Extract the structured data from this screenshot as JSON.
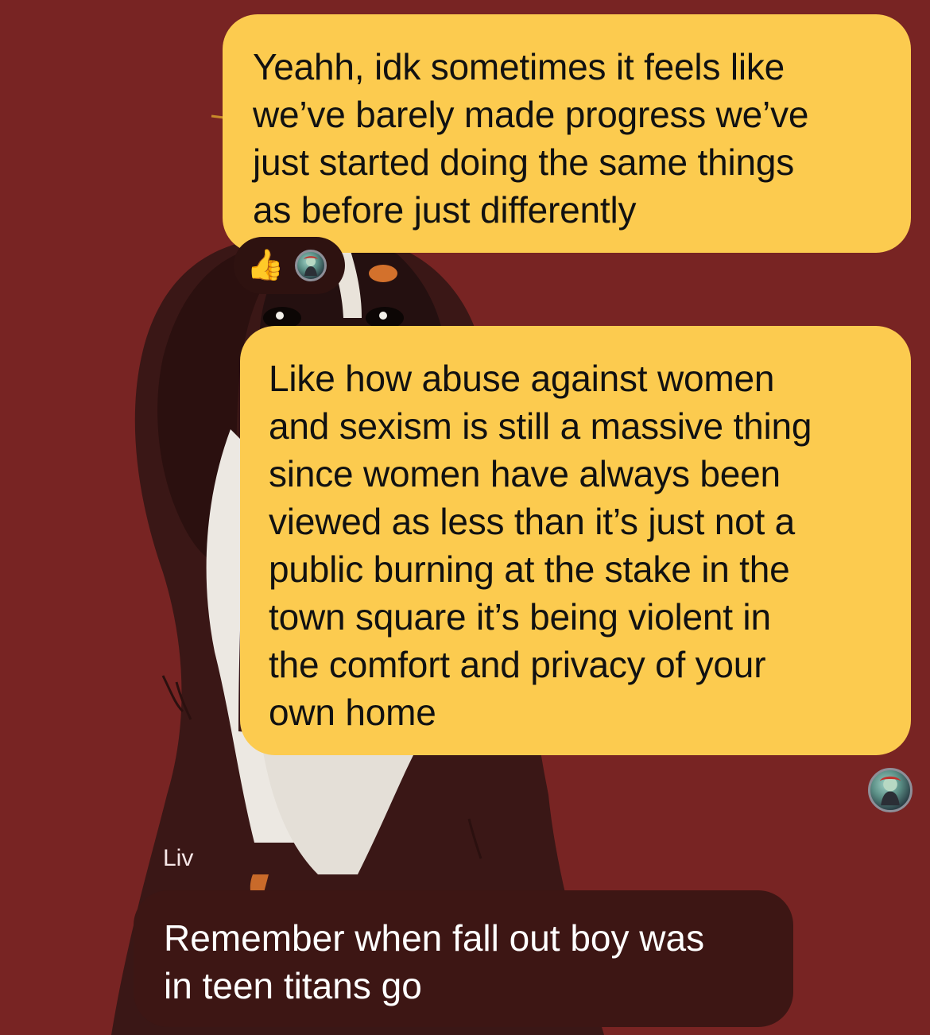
{
  "colors": {
    "background": "#782423",
    "outgoing_bubble": "#fccb4f",
    "incoming_bubble": "#3d1614"
  },
  "messages": [
    {
      "direction": "outgoing",
      "lines": [
        "Yeahh, idk sometimes it feels like",
        "we’ve barely made progress we’ve",
        "just started doing the same things",
        "as before just differently"
      ],
      "reaction_icon": "thumbs-up-icon"
    },
    {
      "direction": "outgoing",
      "lines": [
        "Like how abuse against women",
        "and sexism is still a massive thing",
        "since women have always been",
        "viewed as less than it’s just not a",
        "public burning at the stake in the",
        "town square it’s being violent in",
        "the comfort and privacy of your",
        "own home"
      ]
    },
    {
      "direction": "incoming",
      "sender": "Liv",
      "lines": [
        "Remember when fall out boy was",
        "in teen titans go"
      ]
    }
  ],
  "reaction": {
    "emoji": "👍"
  }
}
